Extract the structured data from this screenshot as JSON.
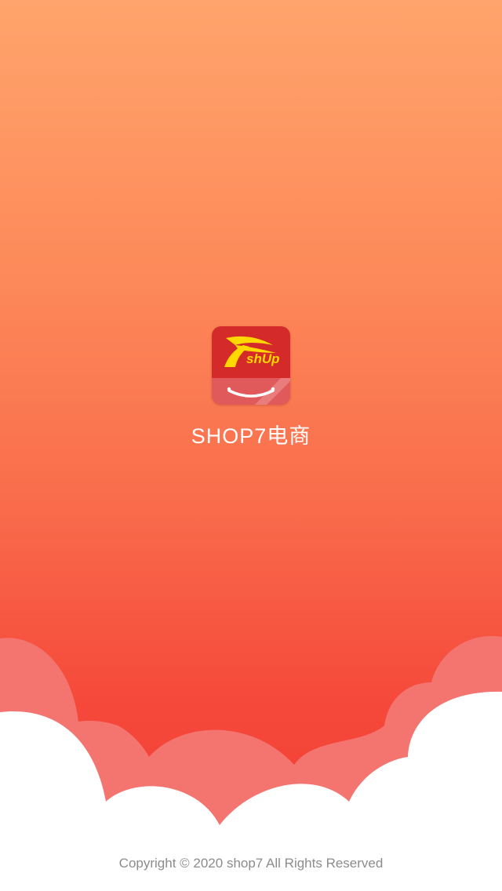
{
  "splash": {
    "app_name": "SHOP7电商",
    "logo": {
      "icon": "shop7-shopping-bag-logo",
      "wordmark": "shUp",
      "primary_color": "#d42a2a",
      "accent_color": "#ffd800"
    },
    "copyright": "Copyright © 2020 shop7 All Rights Reserved"
  },
  "colors": {
    "background_top": "#ffa46c",
    "background_bottom": "#f23e34",
    "cloud_back": "#f47470",
    "cloud_front": "#ffffff",
    "copyright_text": "#8c8c8c"
  }
}
